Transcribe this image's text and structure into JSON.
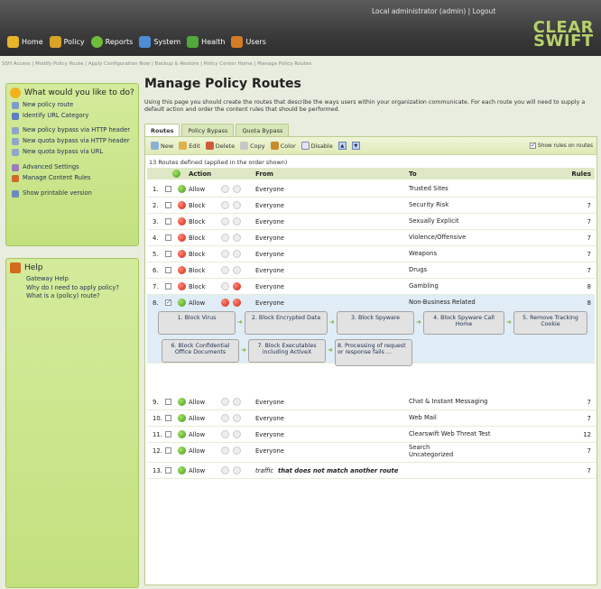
{
  "header": {
    "user_text": "Local administrator (admin) | Logout",
    "logo_line1": "CLEAR",
    "logo_line2": "SWIFT",
    "nav": [
      {
        "label": "Home",
        "color": "#e8b42a"
      },
      {
        "label": "Policy",
        "color": "#d9a22a"
      },
      {
        "label": "Reports",
        "color": "#6fbd3b"
      },
      {
        "label": "System",
        "color": "#4f8ed6"
      },
      {
        "label": "Health",
        "color": "#52a83a"
      },
      {
        "label": "Users",
        "color": "#d47b27"
      }
    ]
  },
  "breadcrumb": "SSH Access | Modify Policy Route | Apply Configuration Now | Backup & Restore | Policy Center Home | Manage Policy Routes",
  "sidebar": {
    "todo_title": "What would you like to do?",
    "todo_items": [
      "New policy route",
      "Identify URL Category",
      "New policy bypass via HTTP header",
      "New quota bypass via HTTP header",
      "New quota bypass via URL",
      "Advanced Settings",
      "Manage Content Rules",
      "Show printable version"
    ],
    "help_title": "Help",
    "help_items": [
      "Gateway Help",
      "Why do I need to apply policy?",
      "What is a (policy) route?"
    ]
  },
  "main": {
    "title": "Manage Policy Routes",
    "description": "Using this page you should create the routes that describe the ways users within your organization communicate. For each route you will need to supply a default action and order the content rules that should be performed.",
    "tabs": [
      "Routes",
      "Policy Bypass",
      "Quota Bypass"
    ],
    "toolbar": {
      "new": "New",
      "edit": "Edit",
      "delete": "Delete",
      "copy": "Copy",
      "color": "Color",
      "disable": "Disable",
      "show_rules": "Show rules on routes"
    },
    "summary": "13 Routes defined (applied in the order shown)",
    "columns": {
      "action": "Action",
      "from": "From",
      "to": "To",
      "rules": "Rules"
    },
    "routes": [
      {
        "num": "1.",
        "action": "Allow",
        "from": "Everyone",
        "to": "Trusted Sites",
        "rules": ""
      },
      {
        "num": "2.",
        "action": "Block",
        "from": "Everyone",
        "to": "Security Risk",
        "rules": "7"
      },
      {
        "num": "3.",
        "action": "Block",
        "from": "Everyone",
        "to": "Sexually Explicit",
        "rules": "7"
      },
      {
        "num": "4.",
        "action": "Block",
        "from": "Everyone",
        "to": "Violence/Offensive",
        "rules": "7"
      },
      {
        "num": "5.",
        "action": "Block",
        "from": "Everyone",
        "to": "Weapons",
        "rules": "7"
      },
      {
        "num": "6.",
        "action": "Block",
        "from": "Everyone",
        "to": "Drugs",
        "rules": "7"
      },
      {
        "num": "7.",
        "action": "Block",
        "from": "Everyone",
        "to": "Gambling",
        "rules": "8"
      },
      {
        "num": "8.",
        "action": "Allow",
        "from": "Everyone",
        "to": "Non-Business Related",
        "rules": "8"
      },
      {
        "num": "9.",
        "action": "Allow",
        "from": "Everyone",
        "to": "Chat & Instant Messaging",
        "rules": "7"
      },
      {
        "num": "10.",
        "action": "Allow",
        "from": "Everyone",
        "to": "Web Mail",
        "rules": "7"
      },
      {
        "num": "11.",
        "action": "Allow",
        "from": "Everyone",
        "to": "Clearswift Web Threat Test",
        "rules": "12"
      },
      {
        "num": "12.",
        "action": "Allow",
        "from": "Everyone",
        "to": "Search\nUncategorized",
        "rules": "7"
      },
      {
        "num": "13.",
        "action": "Allow",
        "from": "traffic",
        "to": "that does not match another route",
        "rules": "7"
      }
    ],
    "rule_flow": [
      "1. Block Virus",
      "2. Block Encrypted Data",
      "3. Block Spyware",
      "4. Block Spyware Call Home",
      "5. Remove Tracking Cookie",
      "6. Block Confidential Office Documents",
      "7. Block Executables including ActiveX",
      "8. Processing of request or response fails ..."
    ]
  }
}
